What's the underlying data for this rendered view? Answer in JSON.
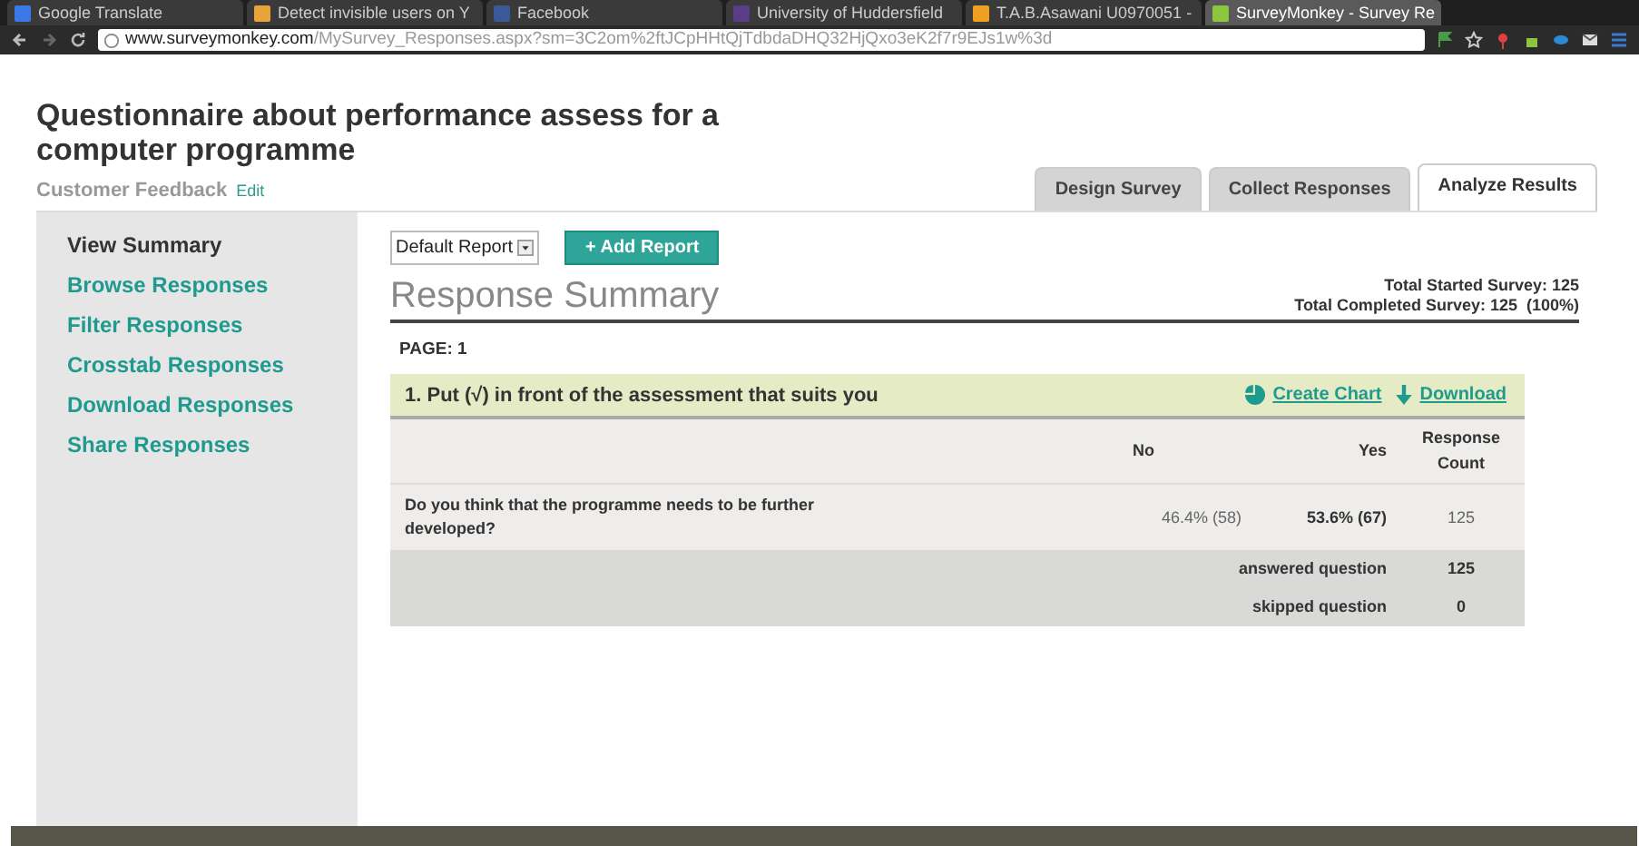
{
  "browser": {
    "tabs": [
      {
        "title": "Google Translate",
        "selected": false,
        "color": "#3b78e7"
      },
      {
        "title": "Detect invisible users on Y",
        "selected": false,
        "color": "#e8a33a"
      },
      {
        "title": "Facebook",
        "selected": false,
        "color": "#3b5998"
      },
      {
        "title": "University of Huddersfield",
        "selected": false,
        "color": "#5a3d8a"
      },
      {
        "title": "T.A.B.Asawani U0970051 -",
        "selected": false,
        "color": "#f0a020"
      },
      {
        "title": "SurveyMonkey - Survey Re",
        "selected": true,
        "color": "#8cc63f"
      }
    ],
    "address_host": "www.surveymonkey.com",
    "address_path": "/MySurvey_Responses.aspx?sm=3C2om%2ftJCpHHtQjTdbdaDHQ32HjQxo3eK2f7r9EJs1w%3d"
  },
  "survey": {
    "title": "Questionnaire about performance assess for a computer programme",
    "category": "Customer Feedback",
    "edit_link": "Edit"
  },
  "nav_tabs": [
    {
      "label": "Design Survey",
      "selected": false
    },
    {
      "label": "Collect Responses",
      "selected": false
    },
    {
      "label": "Analyze Results",
      "selected": true
    }
  ],
  "sidebar": {
    "items": [
      {
        "label": "View Summary",
        "selected": true
      },
      {
        "label": "Browse Responses",
        "selected": false
      },
      {
        "label": "Filter Responses",
        "selected": false
      },
      {
        "label": "Crosstab Responses",
        "selected": false
      },
      {
        "label": "Download Responses",
        "selected": false
      },
      {
        "label": "Share Responses",
        "selected": false
      }
    ]
  },
  "report": {
    "select_value": "Default Report",
    "add_button": "+ Add Report",
    "heading": "Response Summary",
    "totals": [
      "Total Started Survey: 125",
      "Total Completed Survey: 125  (100%)"
    ],
    "page": "PAGE: 1"
  },
  "question": {
    "title": "1. Put (√) in front of the assessment that suits you",
    "create_chart": "Create Chart",
    "download": "Download",
    "columns": [
      "No",
      "Yes",
      "Response Count"
    ],
    "rows": [
      {
        "text": "Do you think that the programme needs to be further developed?",
        "cells": [
          {
            "value": "46.4% (58)",
            "highest": false
          },
          {
            "value": "53.6% (67)",
            "highest": true
          }
        ],
        "count": "125"
      }
    ],
    "summary": [
      {
        "label": "answered question",
        "value": "125"
      },
      {
        "label": "skipped question",
        "value": "0"
      }
    ]
  }
}
